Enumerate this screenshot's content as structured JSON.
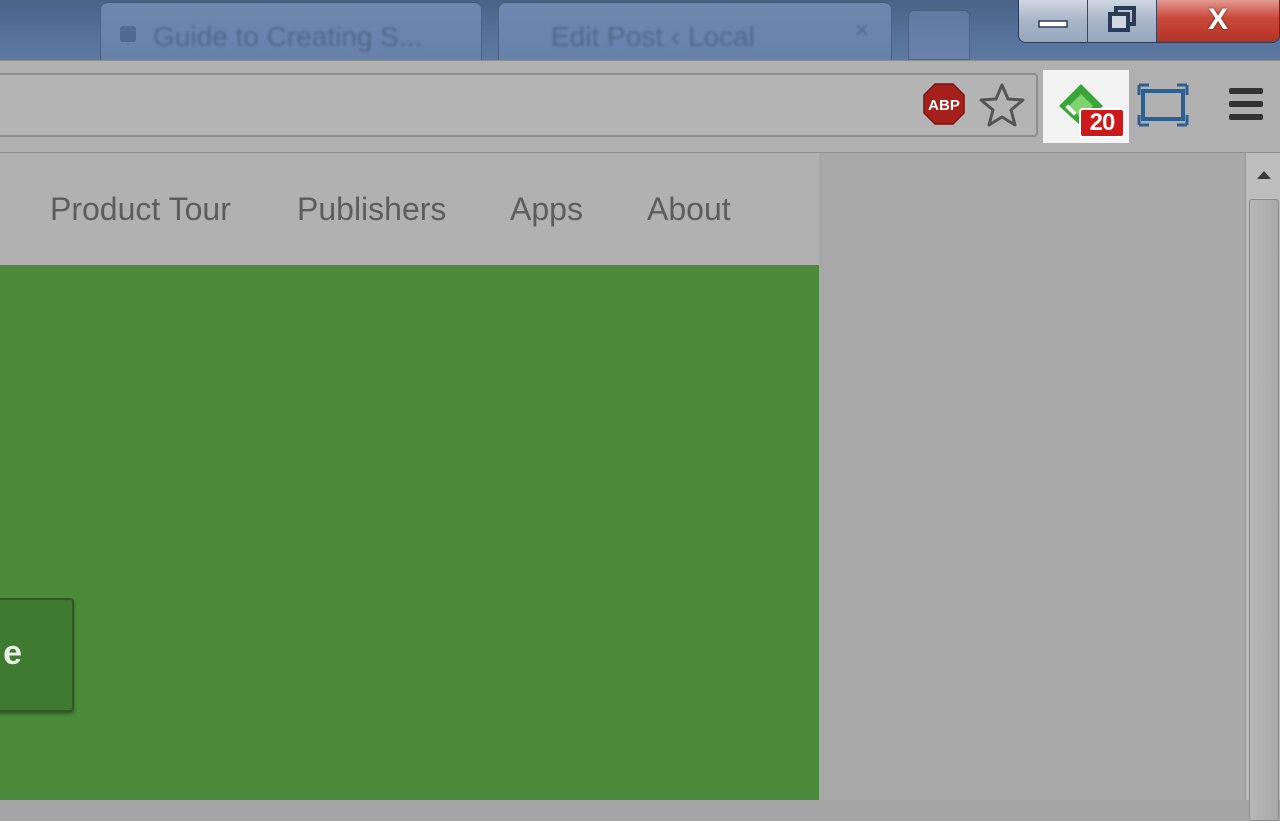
{
  "browser": {
    "tabs": [
      {
        "title": "Guide to Creating S...",
        "close": "×"
      },
      {
        "title": "Edit Post ‹ Local",
        "close": "×"
      }
    ],
    "window_controls": {
      "close": "X"
    },
    "extensions": {
      "abp_label": "ABP",
      "feedly_unread_count": "20"
    }
  },
  "page": {
    "nav": [
      "Product Tour",
      "Publishers",
      "Apps",
      "About"
    ],
    "hero_button_label": "e",
    "colors": {
      "hero": "#4a8a3a",
      "nav_bg": "#b1b1b1"
    }
  }
}
